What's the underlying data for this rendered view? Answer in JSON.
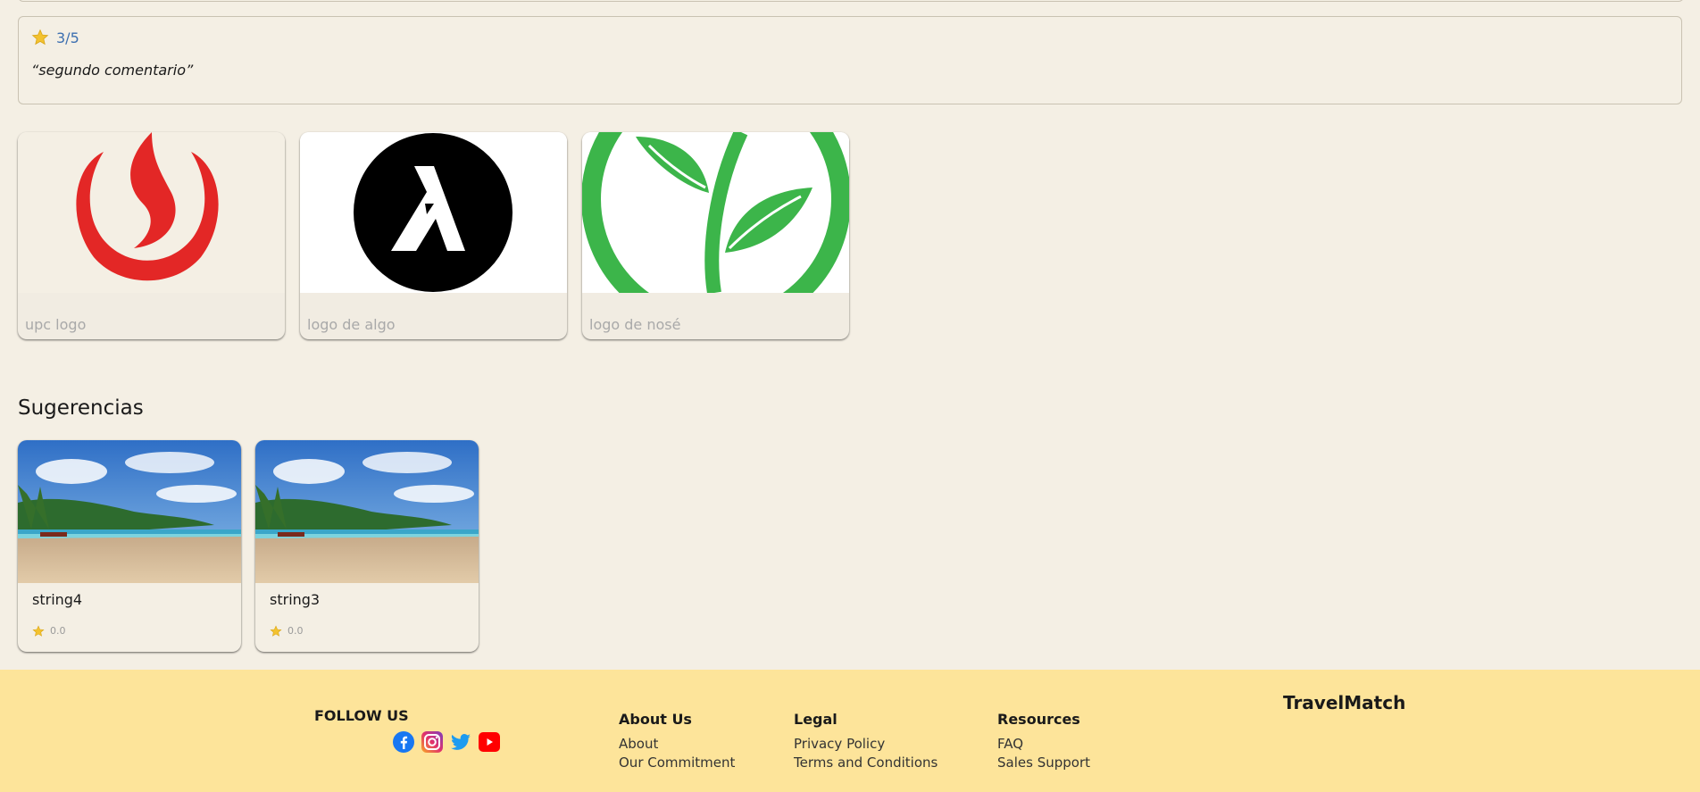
{
  "review": {
    "score": "3/5",
    "text": "“segundo comentario”"
  },
  "photos": [
    {
      "caption": "upc logo"
    },
    {
      "caption": "logo de algo"
    },
    {
      "caption": "logo de nosé"
    }
  ],
  "suggestions": {
    "title": "Sugerencias",
    "items": [
      {
        "title": "string4",
        "rating": "0.0"
      },
      {
        "title": "string3",
        "rating": "0.0"
      }
    ]
  },
  "footer": {
    "follow_us": "FOLLOW US",
    "social_icons": [
      "facebook-icon",
      "instagram-icon",
      "twitter-icon",
      "youtube-icon"
    ],
    "columns": [
      {
        "heading": "About Us",
        "links": [
          "About",
          "Our Commitment"
        ]
      },
      {
        "heading": "Legal",
        "links": [
          "Privacy Policy",
          "Terms and Conditions"
        ]
      },
      {
        "heading": "Resources",
        "links": [
          "FAQ",
          "Sales Support"
        ]
      }
    ],
    "brand": "TravelMatch"
  },
  "colors": {
    "background": "#f4efe4",
    "footer": "#fde49a",
    "star": "#f3c22f",
    "score_link": "#3c6fb0"
  }
}
